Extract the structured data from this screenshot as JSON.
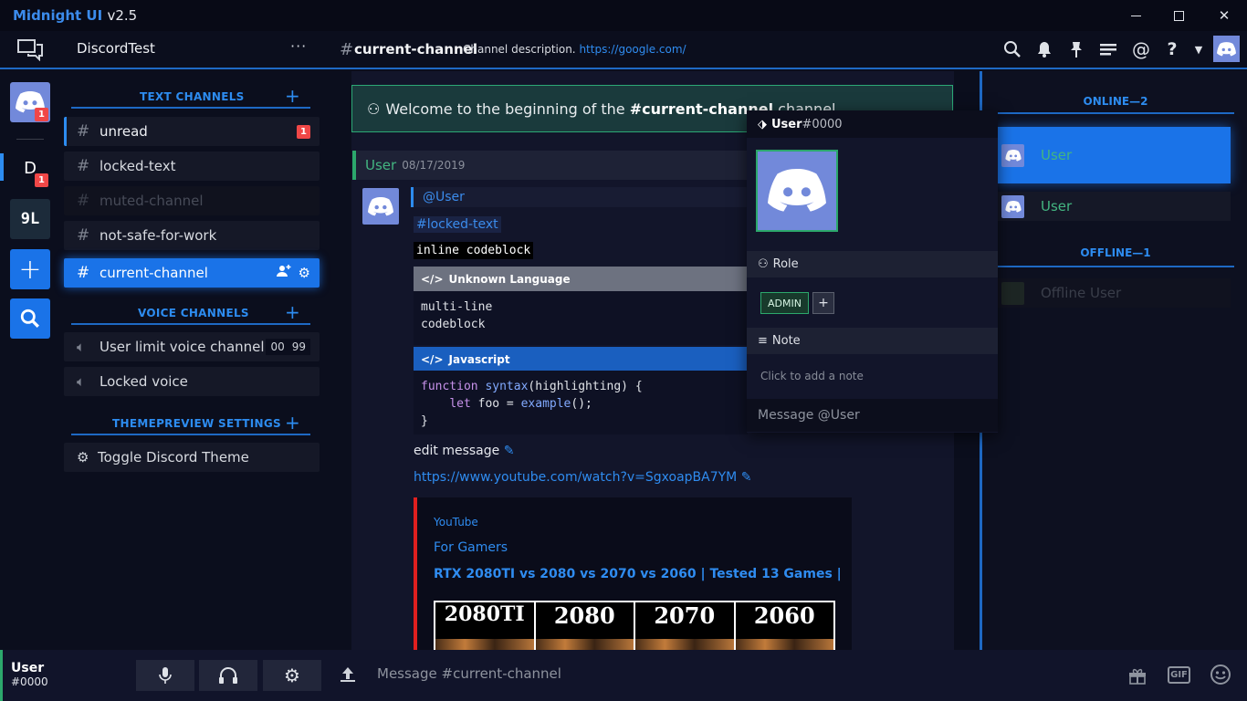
{
  "window": {
    "app_name": "Midnight UI",
    "version": "v2.5"
  },
  "header": {
    "guild_name": "DiscordTest",
    "menu": "···",
    "channel_hash": "#",
    "channel_name": "current-channel",
    "channel_description": "Channel description.",
    "channel_link": "https://google.com/"
  },
  "servers": [
    {
      "name": "home",
      "badge": "1"
    },
    {
      "initial": "D",
      "badge": "1"
    },
    {
      "initial": "9L"
    }
  ],
  "categories": {
    "text": "TEXT CHANNELS",
    "voice": "VOICE CHANNELS",
    "theme": "THEMEPREVIEW SETTINGS"
  },
  "channels": [
    {
      "name": "unread",
      "badge": "1"
    },
    {
      "name": "locked-text"
    },
    {
      "name": "muted-channel"
    },
    {
      "name": "not-safe-for-work"
    },
    {
      "name": "current-channel"
    }
  ],
  "voice_channels": [
    {
      "name": "User limit voice channel",
      "limit_current": "00",
      "limit_max": "99"
    },
    {
      "name": "Locked voice"
    }
  ],
  "theme_settings": {
    "toggle_label": "Toggle Discord Theme"
  },
  "welcome": {
    "prefix": "Welcome to the beginning of the",
    "channel": "#current-channel",
    "suffix": "channel."
  },
  "message": {
    "author": "User",
    "timestamp": "08/17/2019",
    "mention": "@User",
    "channel_link": "#locked-text",
    "inline_code": "inline codeblock",
    "code1_lang": "Unknown Language",
    "code1_body": "multi-line\ncodeblock",
    "code2_lang": "Javascript",
    "edit_text": "edit message",
    "link": "https://www.youtube.com/watch?v=SgxoapBA7YM",
    "embed": {
      "provider": "YouTube",
      "author": "For Gamers",
      "title": "RTX 2080TI vs 2080 vs 2070 vs 2060 | Tested 13 Games |",
      "thumb_labels": [
        "2080TI",
        "2080",
        "2070",
        "2060"
      ]
    }
  },
  "popout": {
    "username": "User",
    "discriminator": "#0000",
    "role_label": "Role",
    "role": "ADMIN",
    "add_role": "+",
    "note_label": "Note",
    "note_placeholder": "Click to add a note",
    "message_placeholder": "Message @User"
  },
  "members": {
    "online_title": "ONLINE—2",
    "offline_title": "OFFLINE—1",
    "online": [
      "User",
      "User"
    ],
    "offline": [
      "Offline User"
    ]
  },
  "account": {
    "username": "User",
    "tag": "#0000"
  },
  "composer": {
    "placeholder": "Message #current-channel"
  },
  "colors": {
    "accent": "#1a73e8",
    "online": "#43b581",
    "badge": "#f04747"
  }
}
